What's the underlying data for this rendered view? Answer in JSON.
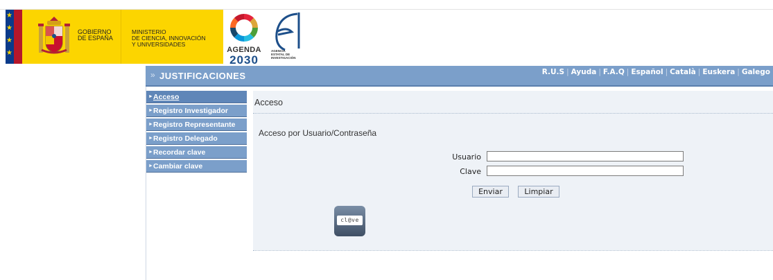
{
  "header": {
    "gov_line1": "GOBIERNO",
    "gov_line2": "DE ESPAÑA",
    "ministry_line1": "MINISTERIO",
    "ministry_line2": "DE CIENCIA, INNOVACIÓN",
    "ministry_line3": "Y UNIVERSIDADES",
    "agenda_word": "AGENDA",
    "agenda_year": "2030",
    "aei_line1": "AGENCIA",
    "aei_line2": "ESTATAL DE",
    "aei_line3": "INVESTIGACIÓN"
  },
  "titlebar": {
    "title": "JUSTIFICACIONES",
    "icon": "double-chevron-right-icon",
    "links": [
      "R.U.S",
      "Ayuda",
      "F.A.Q",
      "Español",
      "Català",
      "Euskera",
      "Galego"
    ]
  },
  "sidebar": {
    "items": [
      {
        "label": "Acceso",
        "active": true
      },
      {
        "label": "Registro Investigador",
        "active": false
      },
      {
        "label": "Registro Representante",
        "active": false
      },
      {
        "label": "Registro Delegado",
        "active": false
      },
      {
        "label": "Recordar clave",
        "active": false
      },
      {
        "label": "Cambiar clave",
        "active": false
      }
    ]
  },
  "main": {
    "title": "Acceso",
    "section_title": "Acceso por Usuario/Contraseña",
    "user_label": "Usuario",
    "user_value": "",
    "password_label": "Clave",
    "password_value": "",
    "send_button": "Enviar",
    "clear_button": "Limpiar",
    "clave_text": "cl@ve"
  },
  "colors": {
    "banner_yellow": "#fcd500",
    "titlebar_blue": "#7b9fca",
    "panel_bg": "#eef2f7"
  }
}
